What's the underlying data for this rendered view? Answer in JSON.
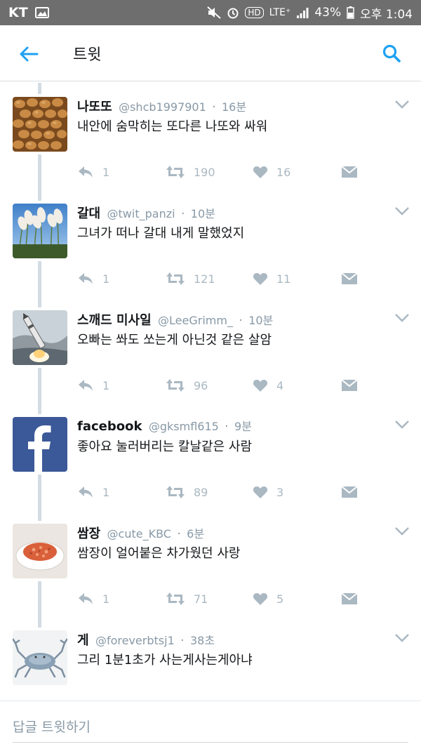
{
  "status_bar": {
    "carrier": "KT",
    "hd": "HD",
    "network": "LTE⁺",
    "battery": "43%",
    "time": "오후 1:04"
  },
  "app_bar": {
    "title": "트윗",
    "back_icon": "arrow-left-icon",
    "search_icon": "search-icon",
    "accent_color": "#1da1f2"
  },
  "tweets": [
    {
      "name": "나또또",
      "handle": "@shcb1997901",
      "time": "16분",
      "text": "내안에 숨막히는 또다른 나또와 싸워",
      "reply_count": "1",
      "retweet_count": "190",
      "like_count": "16",
      "avatar_desc": "natto"
    },
    {
      "name": "갈대",
      "handle": "@twit_panzi",
      "time": "10분",
      "text": "그녀가 떠나 갈대 내게 말했었지",
      "reply_count": "1",
      "retweet_count": "121",
      "like_count": "11",
      "avatar_desc": "reeds"
    },
    {
      "name": "스깨드 미사일",
      "handle": "@LeeGrimm_",
      "time": "10분",
      "text": "오빠는 쏴도 쏘는게 아닌것 같은 살암",
      "reply_count": "1",
      "retweet_count": "96",
      "like_count": "4",
      "avatar_desc": "missile"
    },
    {
      "name": "facebook",
      "handle": "@gksmfl615",
      "time": "9분",
      "text": "좋아요 눌러버리는 칼날같은 사람",
      "reply_count": "1",
      "retweet_count": "89",
      "like_count": "3",
      "avatar_desc": "facebook-logo"
    },
    {
      "name": "쌈장",
      "handle": "@cute_KBC",
      "time": "6분",
      "text": "쌈장이 얼어붙은 차가웠던 사랑",
      "reply_count": "1",
      "retweet_count": "71",
      "like_count": "5",
      "avatar_desc": "ssamjang"
    },
    {
      "name": "게",
      "handle": "@foreverbtsj1",
      "time": "38초",
      "text": "그리 1분1초가 사는게사는게아냐",
      "reply_count": "",
      "retweet_count": "",
      "like_count": "",
      "avatar_desc": "crab"
    }
  ],
  "composer": {
    "placeholder": "답글 트윗하기"
  }
}
